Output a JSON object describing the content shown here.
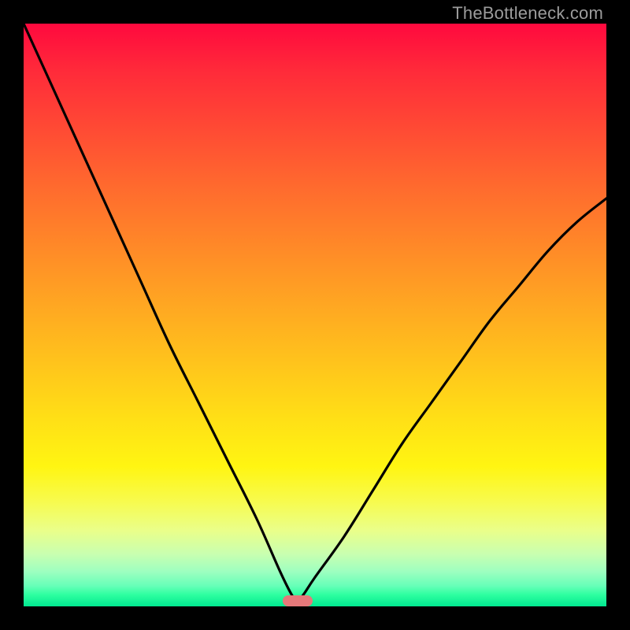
{
  "watermark": {
    "text": "TheBottleneck.com"
  },
  "colors": {
    "frame": "#000000",
    "curve": "#000000",
    "marker": "#e5787a",
    "watermark": "#9c9c9c"
  },
  "chart_data": {
    "type": "line",
    "title": "",
    "xlabel": "",
    "ylabel": "",
    "xlim": [
      0,
      100
    ],
    "ylim": [
      0,
      100
    ],
    "grid": false,
    "legend": false,
    "annotations": [
      {
        "type": "marker",
        "x": 47,
        "y": 1,
        "shape": "pill",
        "color": "#e5787a"
      }
    ],
    "background_gradient_stops": [
      {
        "pos": 0,
        "color": "#ff093e"
      },
      {
        "pos": 18,
        "color": "#ff4a34"
      },
      {
        "pos": 38,
        "color": "#ff8828"
      },
      {
        "pos": 58,
        "color": "#ffc31c"
      },
      {
        "pos": 76,
        "color": "#fff512"
      },
      {
        "pos": 91,
        "color": "#c9ffb0"
      },
      {
        "pos": 100,
        "color": "#00e890"
      }
    ],
    "series": [
      {
        "name": "bottleneck-curve",
        "x": [
          0,
          5,
          10,
          15,
          20,
          25,
          30,
          35,
          40,
          44,
          46,
          47,
          48,
          50,
          55,
          60,
          65,
          70,
          75,
          80,
          85,
          90,
          95,
          100
        ],
        "y": [
          100,
          89,
          78,
          67,
          56,
          45,
          35,
          25,
          15,
          6,
          2,
          1,
          2,
          5,
          12,
          20,
          28,
          35,
          42,
          49,
          55,
          61,
          66,
          70
        ]
      }
    ],
    "notes": "Y values are estimated from pixel positions; the curve reaches its minimum (~1) near x≈47 where the pill marker sits, rises steeply to 100 at x=0 and to ~70 at x=100."
  }
}
